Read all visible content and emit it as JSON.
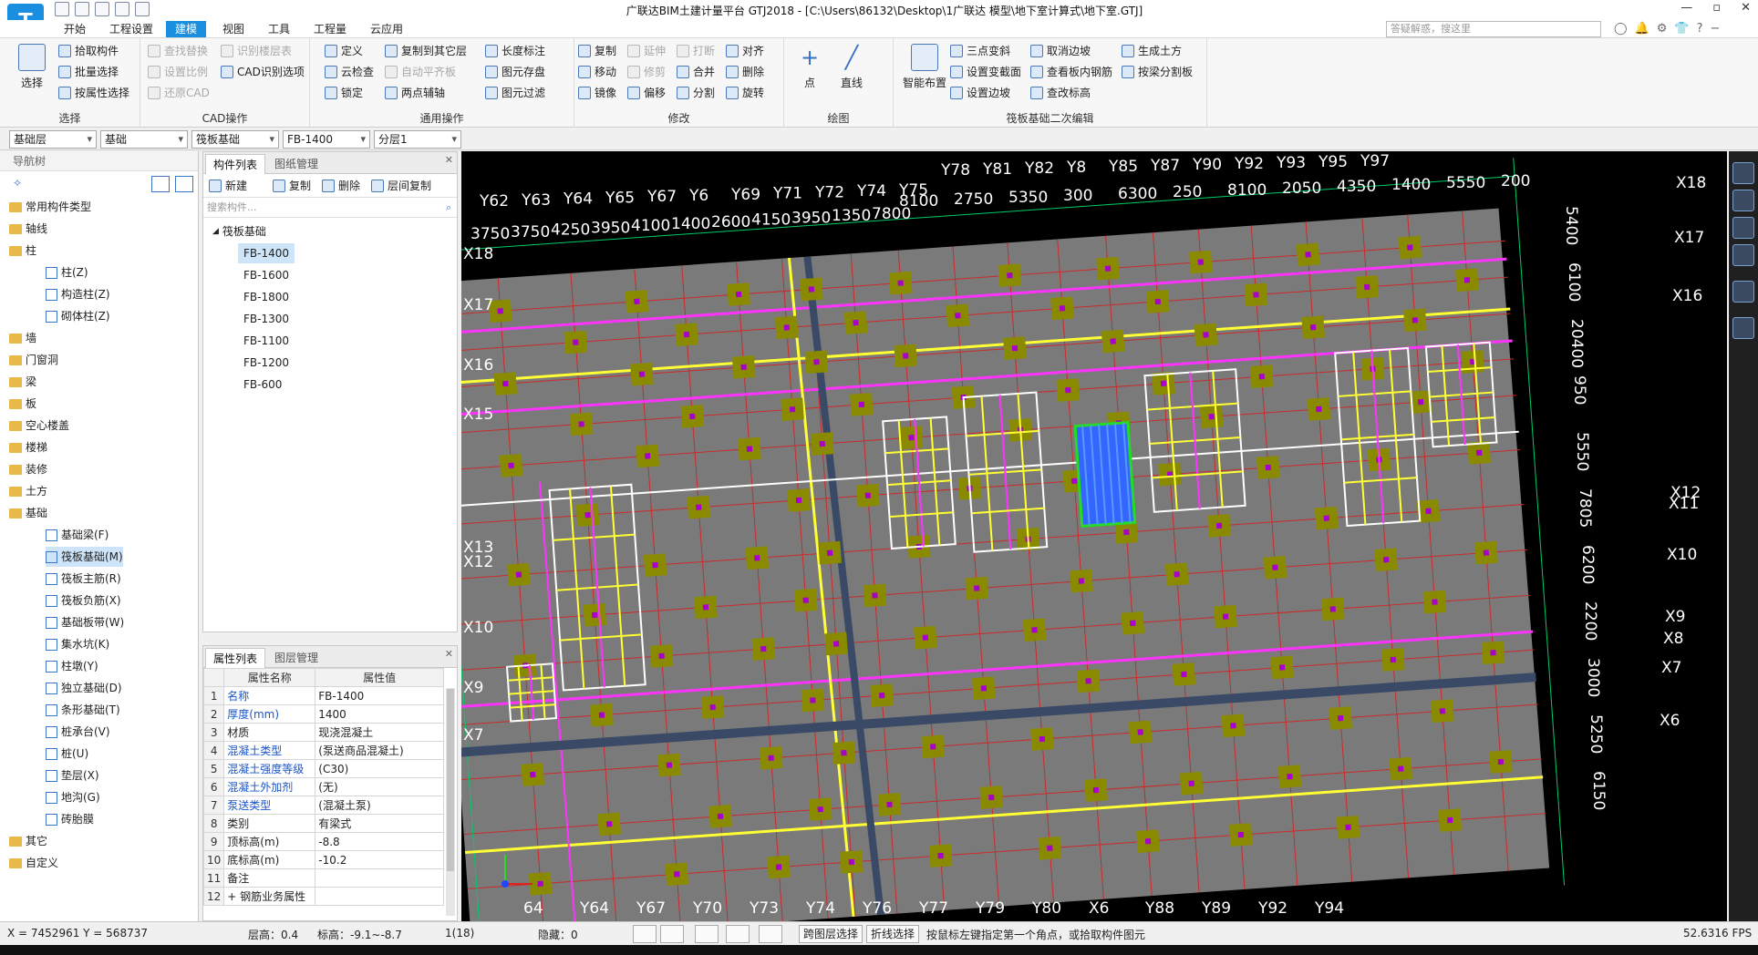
{
  "app": {
    "logo": "T",
    "title": "广联达BIM土建计量平台 GTJ2018 - [C:\\Users\\86132\\Desktop\\1广联达 模型\\地下室计算式\\地下室.GTJ]",
    "window_controls": [
      "—",
      "▫",
      "✕"
    ]
  },
  "menu": {
    "items": [
      "开始",
      "工程设置",
      "建模",
      "视图",
      "工具",
      "工程量",
      "云应用"
    ],
    "active": "建模",
    "search_placeholder": "答疑解惑，搜这里",
    "icons": [
      "◯",
      "🔔",
      "⚙",
      "👕",
      "?",
      "−"
    ]
  },
  "ribbon": {
    "select": {
      "big": "选择",
      "buttons": [
        "拾取构件",
        "批量选择",
        "按属性选择"
      ],
      "label": "选择"
    },
    "cad": {
      "buttons": [
        "查找替换",
        "设置比例",
        "还原CAD",
        "识别楼层表",
        "CAD识别选项"
      ],
      "label": "CAD操作"
    },
    "general": {
      "buttons": [
        "定义",
        "云检查",
        "锁定",
        "复制到其它层",
        "自动平齐板",
        "两点辅轴",
        "长度标注",
        "图元存盘",
        "图元过滤"
      ],
      "label": "通用操作"
    },
    "modify": {
      "buttons": [
        "复制",
        "移动",
        "镜像",
        "延伸",
        "修剪",
        "偏移",
        "打断",
        "合并",
        "分割",
        "对齐",
        "删除",
        "旋转"
      ],
      "label": "修改"
    },
    "draw": {
      "buttons": [
        "点",
        "直线"
      ],
      "label": "绘图"
    },
    "raft": {
      "big": "智能布置",
      "buttons": [
        "三点变斜",
        "设置变截面",
        "设置边坡",
        "取消边坡",
        "查看板内钢筋",
        "查改标高",
        "生成土方",
        "按梁分割板"
      ],
      "label": "筏板基础二次编辑"
    }
  },
  "combos": [
    "基础层",
    "基础",
    "筏板基础",
    "FB-1400",
    "分层1"
  ],
  "nav": {
    "title": "导航树",
    "items": [
      {
        "label": "常用构件类型",
        "type": "folder"
      },
      {
        "label": "轴线",
        "type": "folder"
      },
      {
        "label": "柱",
        "type": "folder"
      },
      {
        "label": "柱(Z)",
        "type": "sub"
      },
      {
        "label": "构造柱(Z)",
        "type": "sub"
      },
      {
        "label": "砌体柱(Z)",
        "type": "sub"
      },
      {
        "label": "墙",
        "type": "folder"
      },
      {
        "label": "门窗洞",
        "type": "folder"
      },
      {
        "label": "梁",
        "type": "folder"
      },
      {
        "label": "板",
        "type": "folder"
      },
      {
        "label": "空心楼盖",
        "type": "folder"
      },
      {
        "label": "楼梯",
        "type": "folder"
      },
      {
        "label": "装修",
        "type": "folder"
      },
      {
        "label": "土方",
        "type": "folder"
      },
      {
        "label": "基础",
        "type": "folder"
      },
      {
        "label": "基础梁(F)",
        "type": "sub"
      },
      {
        "label": "筏板基础(M)",
        "type": "sub",
        "selected": true
      },
      {
        "label": "筏板主筋(R)",
        "type": "sub"
      },
      {
        "label": "筏板负筋(X)",
        "type": "sub"
      },
      {
        "label": "基础板带(W)",
        "type": "sub"
      },
      {
        "label": "集水坑(K)",
        "type": "sub"
      },
      {
        "label": "柱墩(Y)",
        "type": "sub"
      },
      {
        "label": "独立基础(D)",
        "type": "sub"
      },
      {
        "label": "条形基础(T)",
        "type": "sub"
      },
      {
        "label": "桩承台(V)",
        "type": "sub"
      },
      {
        "label": "桩(U)",
        "type": "sub"
      },
      {
        "label": "垫层(X)",
        "type": "sub"
      },
      {
        "label": "地沟(G)",
        "type": "sub"
      },
      {
        "label": "砖胎膜",
        "type": "sub"
      },
      {
        "label": "其它",
        "type": "folder"
      },
      {
        "label": "自定义",
        "type": "folder"
      }
    ]
  },
  "components": {
    "tabs": [
      "构件列表",
      "图纸管理"
    ],
    "toolbar": [
      "新建",
      "复制",
      "删除",
      "层间复制"
    ],
    "search_placeholder": "搜索构件...",
    "group": "筏板基础",
    "items": [
      "FB-1400",
      "FB-1600",
      "FB-1800",
      "FB-1300",
      "FB-1100",
      "FB-1200",
      "FB-600"
    ],
    "selected": "FB-1400"
  },
  "properties": {
    "tabs": [
      "属性列表",
      "图层管理"
    ],
    "headers": [
      "属性名称",
      "属性值"
    ],
    "rows": [
      {
        "n": "1",
        "name": "名称",
        "value": "FB-1400"
      },
      {
        "n": "2",
        "name": "厚度(mm)",
        "value": "1400"
      },
      {
        "n": "3",
        "name": "材质",
        "value": "现浇混凝土"
      },
      {
        "n": "4",
        "name": "混凝土类型",
        "value": "(泵送商品混凝土)"
      },
      {
        "n": "5",
        "name": "混凝土强度等级",
        "value": "(C30)"
      },
      {
        "n": "6",
        "name": "混凝土外加剂",
        "value": "(无)"
      },
      {
        "n": "7",
        "name": "泵送类型",
        "value": "(混凝土泵)"
      },
      {
        "n": "8",
        "name": "类别",
        "value": "有梁式"
      },
      {
        "n": "9",
        "name": "顶标高(m)",
        "value": "-8.8"
      },
      {
        "n": "10",
        "name": "底标高(m)",
        "value": "-10.2"
      },
      {
        "n": "11",
        "name": "备注",
        "value": ""
      },
      {
        "n": "12",
        "name": "+ 钢筋业务属性",
        "value": ""
      }
    ]
  },
  "canvas": {
    "top_axes": [
      "Y62",
      "Y63",
      "Y64",
      "Y65",
      "Y67",
      "Y6",
      "Y69",
      "Y71",
      "Y72",
      "Y74",
      "Y75",
      "Y78",
      "Y81",
      "Y82",
      "Y8",
      "Y85",
      "Y87",
      "Y90",
      "Y92",
      "Y93",
      "Y95",
      "Y97"
    ],
    "top_dims_1": [
      "8100",
      "2750",
      "5350",
      "300",
      "6300",
      "250",
      "8100",
      "2050",
      "4350",
      "1400",
      "5550",
      "200"
    ],
    "top_dims_2": [
      "3750",
      "3750",
      "4250",
      "3950",
      "4100",
      "1400",
      "2600",
      "4150",
      "3950",
      "1350",
      "7800"
    ],
    "left_axes": [
      "X18",
      "X17",
      "X16",
      "X15",
      "X13",
      "X12",
      "X10",
      "X9",
      "X7"
    ],
    "right_axes": [
      "X18",
      "X17",
      "X16",
      "X12",
      "X11",
      "X10",
      "X9",
      "X8",
      "X7",
      "X6"
    ],
    "right_dims": [
      "5400",
      "6100",
      "20400",
      "950",
      "5550",
      "7805",
      "6200",
      "2200",
      "3000",
      "5250",
      "6150"
    ],
    "bottom_axes": [
      "64",
      "Y64",
      "Y67",
      "Y70",
      "Y73",
      "Y74",
      "Y76",
      "Y77",
      "Y79",
      "Y80",
      "X6",
      "Y88",
      "Y89",
      "Y92",
      "Y94"
    ],
    "colors": {
      "background": "#000000",
      "slab": "#7a7a7a",
      "grid": "#cc2a2a",
      "beam_yellow": "#ffff33",
      "beam_magenta": "#ff33ff",
      "column": "#8a8a00",
      "axis_label": "#ffffff",
      "grid_line": "#00cc66",
      "selected": "#3366ff"
    }
  },
  "status": {
    "coords": "X = 7452961 Y = 568737",
    "floor_height": "层高：0.4",
    "elevation": "标高：-9.1~-8.7",
    "count": "1(18)",
    "hidden": "隐藏：0",
    "btn_cross_layer": "跨图层选择",
    "btn_polyline": "折线选择",
    "hint": "按鼠标左键指定第一个角点，或拾取构件图元",
    "fps": "52.6316 FPS"
  }
}
